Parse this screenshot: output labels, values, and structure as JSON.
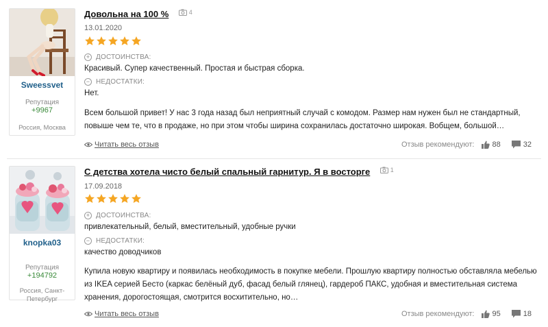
{
  "reviews": [
    {
      "username": "Sweessvet",
      "reputation_label": "Репутация",
      "reputation_value": "+9967",
      "city": "Россия, Москва",
      "title": "Довольна на 100 %",
      "photo_count": "4",
      "date": "13.01.2020",
      "rating": 5,
      "pros_label": "ДОСТОИНСТВА:",
      "pros_text": "Красивый. Супер качественный. Простая и быстрая сборка.",
      "cons_label": "НЕДОСТАТКИ:",
      "cons_text": "Нет.",
      "body": "Всем большой привет! У нас 3 года назад был неприятный случай с комодом. Размер нам нужен был не стандартный, повыше чем те, что в продаже, но при этом чтобы ширина сохранилась достаточно широкая. Вобщем, большой…",
      "read_more": "Читать весь отзыв",
      "recommend_label": "Отзыв рекомендуют:",
      "likes": "88",
      "comments": "32"
    },
    {
      "username": "knopka03",
      "reputation_label": "Репутация",
      "reputation_value": "+194792",
      "city": "Россия, Санкт-Петербург",
      "title": "С детства хотела чисто белый спальный гарнитур. Я в восторге",
      "photo_count": "1",
      "date": "17.09.2018",
      "rating": 5,
      "pros_label": "ДОСТОИНСТВА:",
      "pros_text": "привлекательный, белый, вместительный, удобные ручки",
      "cons_label": "НЕДОСТАТКИ:",
      "cons_text": "качество доводчиков",
      "body": "Купила новую квартиру и появилась необходимость в покупке мебели. Прошлую квартиру полностью обставляла мебелью из IKEA серией Бесто (каркас белёный дуб, фасад белый глянец), гардероб ПАКС, удобная и вместительная система хранения, дорогостоящая, смотрится восхитительно, но…",
      "read_more": "Читать весь отзыв",
      "recommend_label": "Отзыв рекомендуют:",
      "likes": "95",
      "comments": "18"
    }
  ],
  "colors": {
    "star": "#f5a623",
    "username": "#1f5f8a",
    "reputation": "#3a8a3a"
  }
}
